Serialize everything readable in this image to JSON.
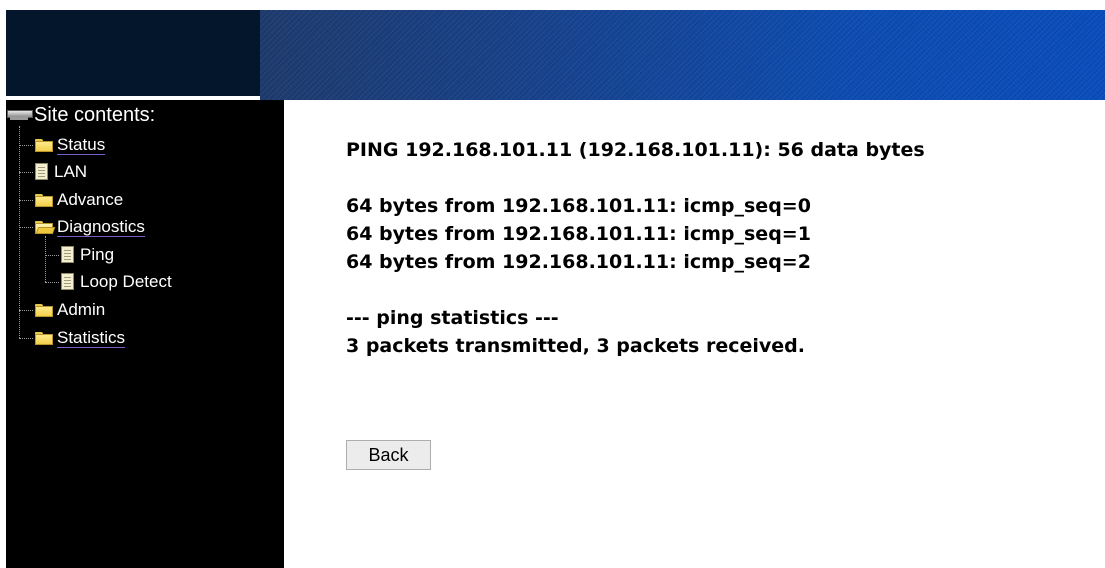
{
  "sidebar": {
    "title": "Site contents:",
    "items": [
      {
        "label": "Status",
        "icon": "folder-icon"
      },
      {
        "label": "LAN",
        "icon": "document-icon"
      },
      {
        "label": "Advance",
        "icon": "folder-icon"
      },
      {
        "label": "Diagnostics",
        "icon": "folder-open-icon",
        "children": [
          {
            "label": "Ping",
            "icon": "document-icon"
          },
          {
            "label": "Loop Detect",
            "icon": "document-icon"
          }
        ]
      },
      {
        "label": "Admin",
        "icon": "folder-icon"
      },
      {
        "label": "Statistics",
        "icon": "folder-icon"
      }
    ]
  },
  "main": {
    "ping_header": "PING 192.168.101.11 (192.168.101.11): 56 data bytes",
    "replies": [
      "64 bytes from 192.168.101.11: icmp_seq=0",
      "64 bytes from 192.168.101.11: icmp_seq=1",
      "64 bytes from 192.168.101.11: icmp_seq=2"
    ],
    "stats_header": "--- ping statistics ---",
    "stats_summary": "3 packets transmitted, 3 packets received.",
    "back_label": "Back"
  },
  "colors": {
    "sidebar_bg": "#000000",
    "banner_dark": "#03162b",
    "banner_blue": "#0d4db3",
    "link_underline": "#7b5fc9"
  }
}
